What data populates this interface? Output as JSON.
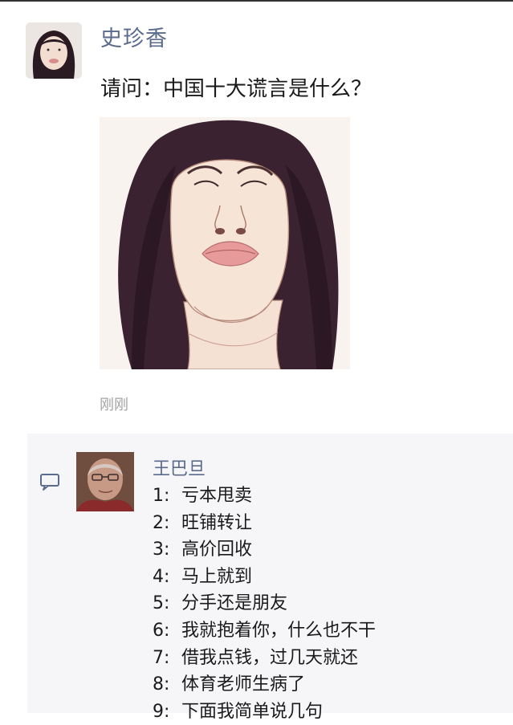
{
  "post": {
    "author": "史珍香",
    "text": "请问：中国十大谎言是什么？",
    "time": "刚刚"
  },
  "comment": {
    "author": "王巴旦",
    "items": [
      {
        "num": "1:",
        "text": "亏本甩卖"
      },
      {
        "num": "2:",
        "text": "旺铺转让"
      },
      {
        "num": "3:",
        "text": "高价回收"
      },
      {
        "num": "4:",
        "text": "马上就到"
      },
      {
        "num": "5:",
        "text": "分手还是朋友"
      },
      {
        "num": "6:",
        "text": "我就抱着你，什么也不干"
      },
      {
        "num": "7:",
        "text": "借我点钱，过几天就还"
      },
      {
        "num": "8:",
        "text": "体育老师生病了"
      },
      {
        "num": "9:",
        "text": "下面我简单说几句"
      }
    ]
  },
  "icons": {
    "comment": "comment-bubble-icon"
  }
}
